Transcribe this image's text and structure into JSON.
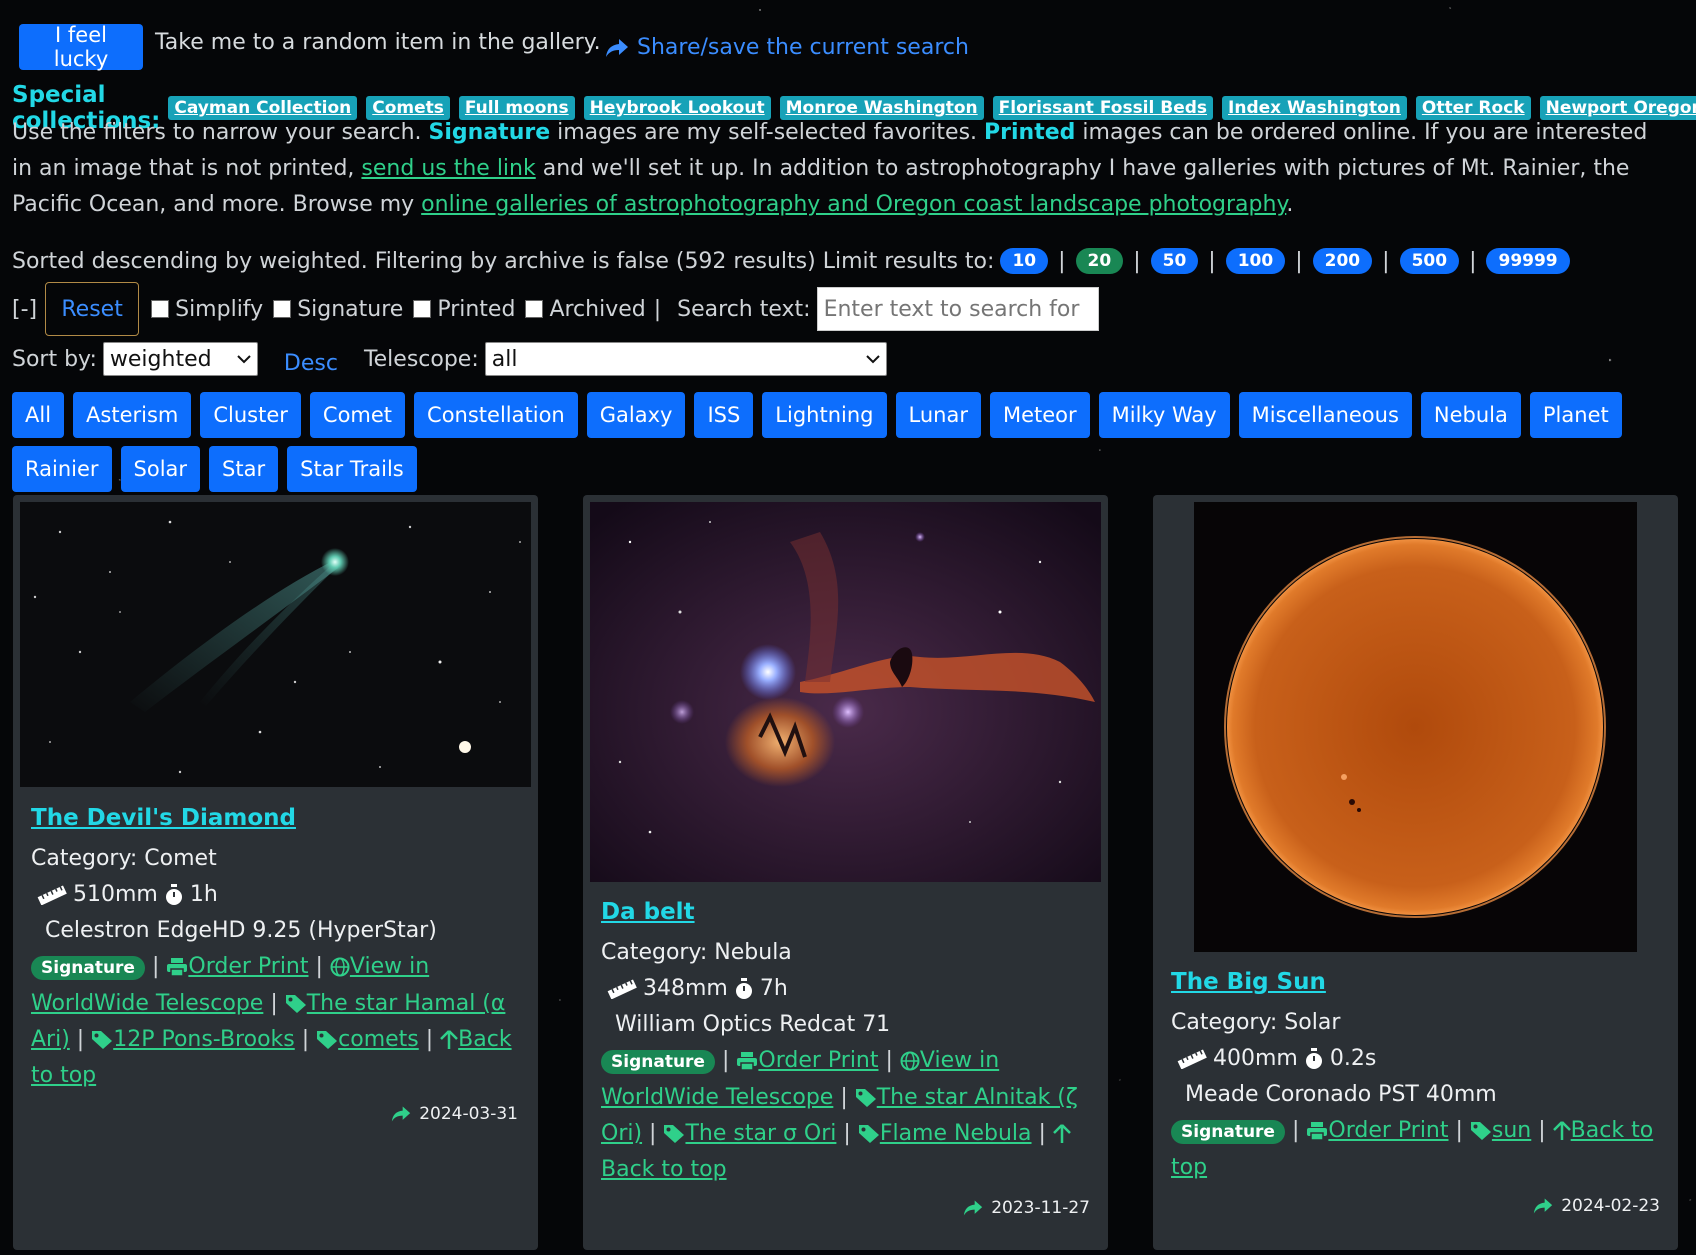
{
  "header": {
    "lucky_label": "I feel lucky",
    "lucky_text": "Take me to a random item in the gallery.",
    "share_label": "Share/save the current search"
  },
  "special": {
    "label": "Special collections:",
    "items": [
      "Cayman Collection",
      "Comets",
      "Full moons",
      "Heybrook Lookout",
      "Monroe Washington",
      "Florissant Fossil Beds",
      "Index Washington",
      "Otter Rock",
      "Newport Oregon"
    ]
  },
  "intro": {
    "p1": "Use the filters to narrow your search. ",
    "signature": "Signature",
    "p2": " images are my self-selected favorites. ",
    "printed": "Printed",
    "p3": " images can be ordered online. If you are interested in an image that is not printed, ",
    "link1": "send us the link",
    "p4": " and we'll set it up. In addition to astrophotography I have galleries with pictures of Mt. Rainier, the Pacific Ocean, and more. Browse my ",
    "link2": "online galleries of astrophotography and Oregon coast landscape photography",
    "p5": "."
  },
  "sorted": {
    "text": "Sorted descending by weighted. Filtering by archive is false (592 results) Limit results to:",
    "limits": [
      "10",
      "20",
      "50",
      "100",
      "200",
      "500",
      "99999"
    ],
    "active_limit": "20"
  },
  "filters": {
    "collapse": "[-]",
    "reset": "Reset",
    "simplify": "Simplify",
    "signature": "Signature",
    "printed": "Printed",
    "archived": "Archived",
    "pipe": "|",
    "search_label": "Search text:",
    "search_placeholder": "Enter text to search for"
  },
  "sort": {
    "label": "Sort by:",
    "value": "weighted",
    "desc": "Desc",
    "telescope_label": "Telescope:",
    "telescope_value": "all"
  },
  "categories": [
    "All",
    "Asterism",
    "Cluster",
    "Comet",
    "Constellation",
    "Galaxy",
    "ISS",
    "Lightning",
    "Lunar",
    "Meteor",
    "Milky Way",
    "Miscellaneous",
    "Nebula",
    "Planet",
    "Rainier",
    "Solar",
    "Star",
    "Star Trails"
  ],
  "cards": [
    {
      "title": "The Devil's Diamond",
      "category": "Category: Comet",
      "focal": "510mm",
      "exposure": "1h",
      "telescope": "Celestron EdgeHD 9.25 (HyperStar)",
      "signature": "Signature",
      "links": [
        "Order Print",
        "View in WorldWide Telescope",
        "The star Hamal (α Ari)",
        "12P Pons-Brooks",
        "comets",
        "Back to top"
      ],
      "date": "2024-03-31"
    },
    {
      "title": "Da belt",
      "category": "Category: Nebula",
      "focal": "348mm",
      "exposure": "7h",
      "telescope": "William Optics Redcat 71",
      "signature": "Signature",
      "links": [
        "Order Print",
        "View in WorldWide Telescope",
        "The star Alnitak (ζ Ori)",
        "The star σ Ori",
        "Flame Nebula",
        "Back to top"
      ],
      "date": "2023-11-27"
    },
    {
      "title": "The Big Sun",
      "category": "Category: Solar",
      "focal": "400mm",
      "exposure": "0.2s",
      "telescope": "Meade Coronado PST 40mm",
      "signature": "Signature",
      "links": [
        "Order Print",
        "sun",
        "Back to top"
      ],
      "date": "2024-02-23"
    }
  ],
  "colors": {
    "accent_blue": "#0d6efd",
    "cyan": "#22d8e6",
    "green_link": "#2fd08a",
    "badge_green": "#198754",
    "card_bg": "#2b3035"
  }
}
